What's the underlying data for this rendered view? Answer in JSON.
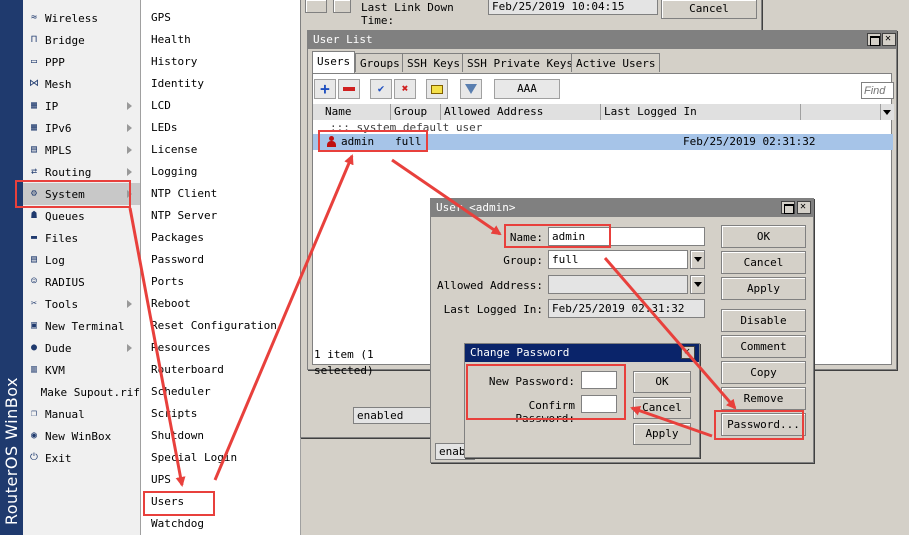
{
  "brand": {
    "text": "RouterOS WinBox"
  },
  "main_menu": [
    {
      "label": "Wireless",
      "icon": "wireless-icon",
      "arrow": false
    },
    {
      "label": "Bridge",
      "icon": "bridge-icon",
      "arrow": false
    },
    {
      "label": "PPP",
      "icon": "ppp-icon",
      "arrow": false
    },
    {
      "label": "Mesh",
      "icon": "mesh-icon",
      "arrow": false
    },
    {
      "label": "IP",
      "icon": "ip-icon",
      "arrow": true
    },
    {
      "label": "IPv6",
      "icon": "ipv6-icon",
      "arrow": true
    },
    {
      "label": "MPLS",
      "icon": "mpls-icon",
      "arrow": true
    },
    {
      "label": "Routing",
      "icon": "routing-icon",
      "arrow": true
    },
    {
      "label": "System",
      "icon": "gear-icon",
      "arrow": true
    },
    {
      "label": "Queues",
      "icon": "queues-icon",
      "arrow": false
    },
    {
      "label": "Files",
      "icon": "folder-icon",
      "arrow": false
    },
    {
      "label": "Log",
      "icon": "log-icon",
      "arrow": false
    },
    {
      "label": "RADIUS",
      "icon": "radius-icon",
      "arrow": false
    },
    {
      "label": "Tools",
      "icon": "tools-icon",
      "arrow": true
    },
    {
      "label": "New Terminal",
      "icon": "terminal-icon",
      "arrow": false
    },
    {
      "label": "Dude",
      "icon": "dude-icon",
      "arrow": true
    },
    {
      "label": "KVM",
      "icon": "kvm-icon",
      "arrow": false
    },
    {
      "label": "Make Supout.rif",
      "icon": "supout-icon",
      "arrow": false
    },
    {
      "label": "Manual",
      "icon": "manual-icon",
      "arrow": false
    },
    {
      "label": "New WinBox",
      "icon": "winbox-icon",
      "arrow": false
    },
    {
      "label": "Exit",
      "icon": "exit-icon",
      "arrow": false
    }
  ],
  "sub_menu": [
    "GPS",
    "Health",
    "History",
    "Identity",
    "LCD",
    "LEDs",
    "License",
    "Logging",
    "NTP Client",
    "NTP Server",
    "Packages",
    "Password",
    "Ports",
    "Reboot",
    "Reset Configuration",
    "Resources",
    "Routerboard",
    "Scheduler",
    "Scripts",
    "Shutdown",
    "Special Login",
    "UPS",
    "Users",
    "Watchdog"
  ],
  "bg_window": {
    "last_link_down_label": "Last Link Down Time:",
    "last_link_down_value": "Feb/25/2019 10:04:15",
    "cancel": "Cancel",
    "enabled_text": "enabled",
    "enabled_text2": "enabl"
  },
  "user_list": {
    "title": "User List",
    "tabs": [
      "Users",
      "Groups",
      "SSH Keys",
      "SSH Private Keys",
      "Active Users"
    ],
    "aaa": "AAA",
    "find_placeholder": "Find",
    "columns": [
      "Name",
      "Group",
      "Allowed Address",
      "Last Logged In"
    ],
    "comment_row": "::: system default user",
    "row": {
      "name": "admin",
      "group": "full",
      "allowed": "",
      "last": "Feb/25/2019 02:31:32"
    },
    "status": "1 item (1 selected)"
  },
  "user_dialog": {
    "title": "User <admin>",
    "name_label": "Name:",
    "name_value": "admin",
    "group_label": "Group:",
    "group_value": "full",
    "allowed_label": "Allowed Address:",
    "last_label": "Last Logged In:",
    "last_value": "Feb/25/2019 02:31:32",
    "buttons": [
      "OK",
      "Cancel",
      "Apply",
      "Disable",
      "Comment",
      "Copy",
      "Remove",
      "Password..."
    ]
  },
  "change_password": {
    "title": "Change Password",
    "new_label": "New Password:",
    "confirm_label": "Confirm Password:",
    "ok": "OK",
    "cancel": "Cancel",
    "apply": "Apply"
  },
  "colors": {
    "annotation": "#e8403c",
    "title_active": "#0a246a",
    "selected_row": "#a6c4e8"
  }
}
